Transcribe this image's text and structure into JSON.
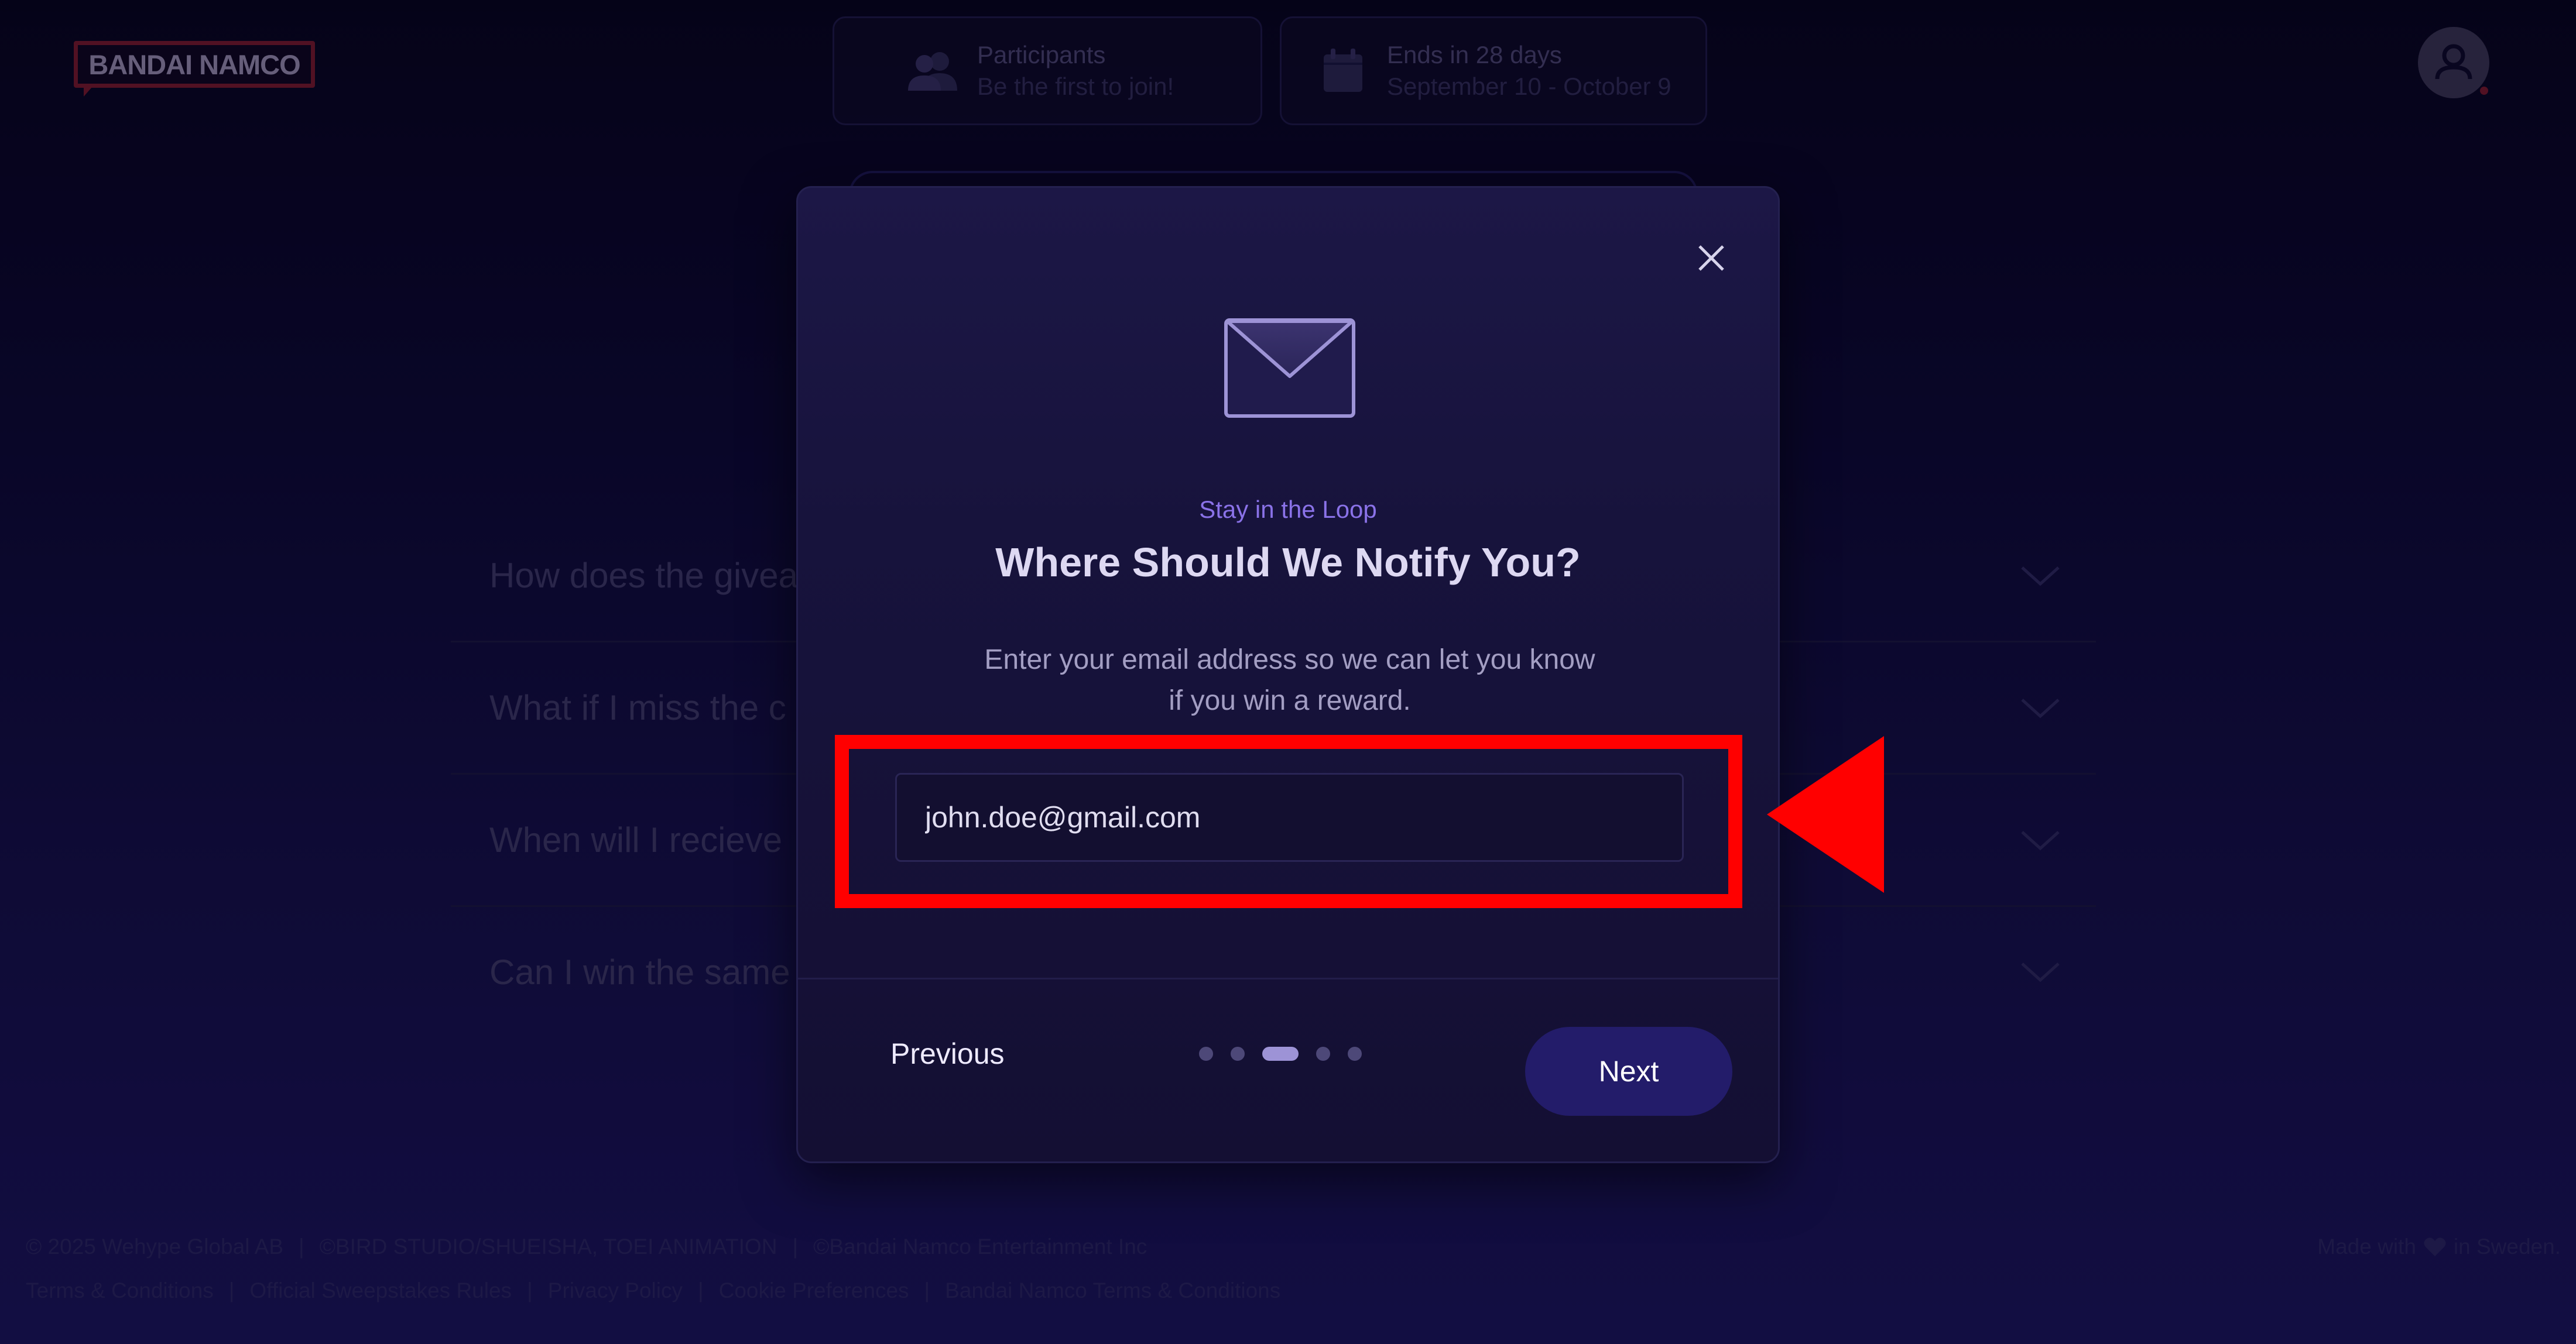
{
  "header": {
    "logo_text": "BANDAI NAMCO",
    "participants": {
      "title": "Participants",
      "subtitle": "Be the first to join!",
      "icon": "users-icon"
    },
    "deadline": {
      "title": "Ends in 28 days",
      "subtitle": "September 10 - October 9",
      "icon": "calendar-icon"
    },
    "avatar_icon": "user-icon"
  },
  "faq": {
    "items": [
      {
        "question": "How does the givea"
      },
      {
        "question": "What if I miss the c"
      },
      {
        "question": "When will I recieve"
      },
      {
        "question": "Can I win the same"
      }
    ]
  },
  "footer": {
    "copyright": "© 2025 Wehype Global AB",
    "credit1": "©BIRD STUDIO/SHUEISHA, TOEI ANIMATION",
    "credit2": "©Bandai Namco Entertainment Inc",
    "links": [
      "Terms & Conditions",
      "Official Sweepstakes Rules",
      "Privacy Policy",
      "Cookie Preferences",
      "Bandai Namco Terms & Conditions"
    ],
    "made_with_prefix": "Made with",
    "made_with_suffix": "in Sweden."
  },
  "modal": {
    "eyebrow": "Stay in the Loop",
    "title": "Where Should We Notify You?",
    "description": "Enter your email address so we can let you know if you win a reward.",
    "email_value": "john.doe@gmail.com",
    "previous_label": "Previous",
    "next_label": "Next",
    "step_current": 3,
    "step_total": 5
  },
  "colors": {
    "accent": "#8a72e8",
    "next_button": "#231c6a",
    "annotation": "#ff0000"
  }
}
